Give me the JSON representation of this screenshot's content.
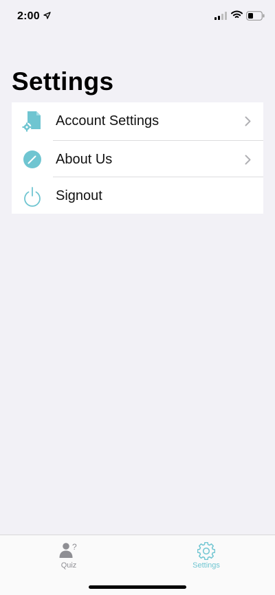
{
  "status_bar": {
    "time": "2:00"
  },
  "page": {
    "title": "Settings"
  },
  "settings_list": {
    "items": [
      {
        "label": "Account Settings",
        "icon": "document-gear-icon",
        "has_chevron": true
      },
      {
        "label": "About Us",
        "icon": "pencil-circle-icon",
        "has_chevron": true
      },
      {
        "label": "Signout",
        "icon": "power-icon",
        "has_chevron": false
      }
    ]
  },
  "tab_bar": {
    "tabs": [
      {
        "label": "Quiz",
        "icon": "person-question-icon",
        "active": false
      },
      {
        "label": "Settings",
        "icon": "gear-icon",
        "active": true
      }
    ]
  },
  "colors": {
    "accent": "#6fc5d1",
    "background": "#f2f1f6",
    "inactive_tab": "#8e8e93"
  }
}
